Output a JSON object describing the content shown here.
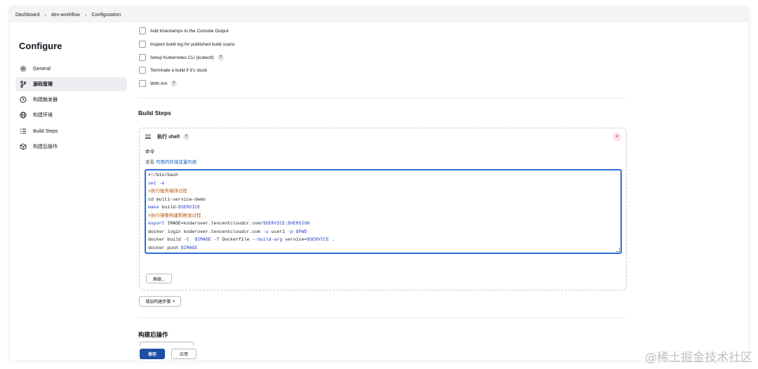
{
  "breadcrumb": [
    "Dashboard",
    "dev-workflow",
    "Configuration"
  ],
  "sidebar": {
    "title": "Configure",
    "items": [
      {
        "label": "General",
        "icon": "gear-icon"
      },
      {
        "label": "源码管理",
        "icon": "branch-icon",
        "active": true
      },
      {
        "label": "构建触发器",
        "icon": "clock-icon"
      },
      {
        "label": "构建环境",
        "icon": "globe-icon"
      },
      {
        "label": "Build Steps",
        "icon": "list-icon"
      },
      {
        "label": "构建后操作",
        "icon": "cube-icon"
      }
    ]
  },
  "options": [
    {
      "label": "Add timestamps to the Console Output",
      "help": false
    },
    {
      "label": "Inspect build log for published build scans",
      "help": false
    },
    {
      "label": "Setup Kubernetes CLI (kubectl)",
      "help": true
    },
    {
      "label": "Terminate a build if it's stuck",
      "help": false
    },
    {
      "label": "With Ant",
      "help": true
    }
  ],
  "help_glyph": "?",
  "build_steps": {
    "title": "Build Steps",
    "step_title": "执行 shell",
    "close_glyph": "×",
    "command_label": "命令",
    "env_prefix": "查看",
    "env_link": "可用的环境变量列表",
    "script_lines": [
      "#!/bin/bash",
      "set -e",
      "#执行服务编译过程",
      "cd multi-service-demo",
      "make build-$SERVICE",
      "#执行镜像构建和推送过程",
      "export IMAGE=koderover.tencentcloudcr.com/$SERVICE:$VERSION",
      "docker login koderover.tencentcloudcr.com -u user1 -p $PWD",
      "docker build -t  $IMAGE -f Dockerfile --build-arg service=$SERVICE .",
      "docker push $IMAGE"
    ],
    "advanced_label": "高级...",
    "add_step_label": "增加构建步骤",
    "caret": "▾"
  },
  "post_build": {
    "title": "构建后操作"
  },
  "footer": {
    "save_label": "保存",
    "apply_label": "应用"
  },
  "watermark": "@稀土掘金技术社区",
  "colors": {
    "primary": "#1f4ea6",
    "link": "#1663c7",
    "focus": "#2a6fd6",
    "comment": "#b35a12",
    "keyword": "#1d3ec0"
  }
}
